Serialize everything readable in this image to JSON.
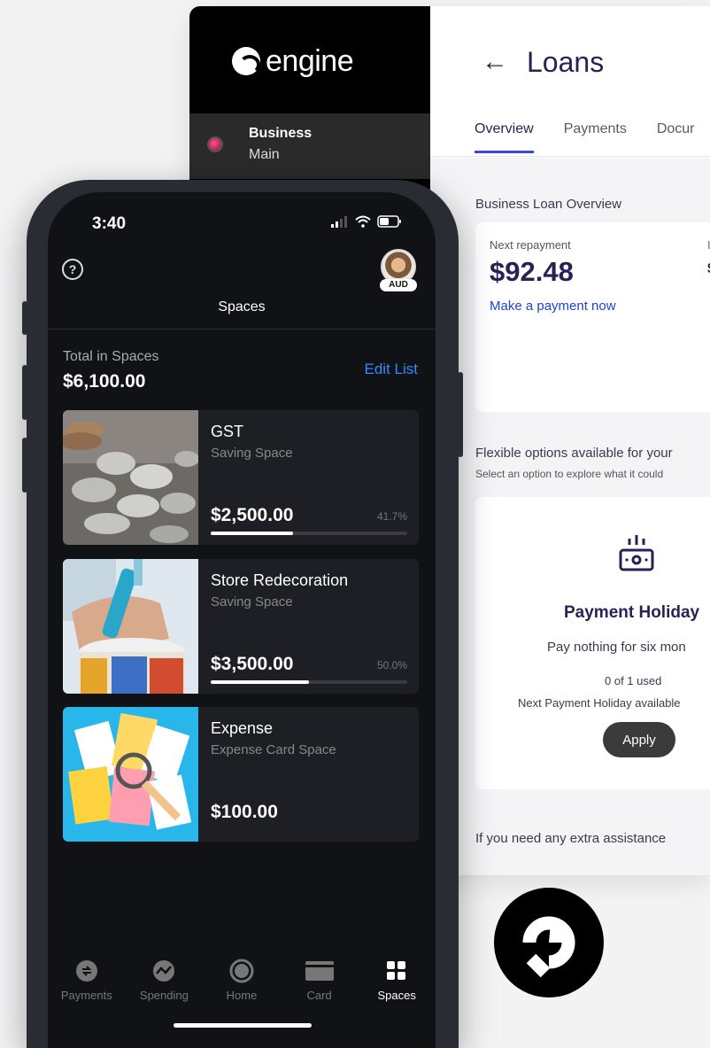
{
  "desktop": {
    "brand": "engine",
    "account": {
      "name": "Business",
      "sub": "Main"
    },
    "page_title": "Loans",
    "tabs": [
      "Overview",
      "Payments",
      "Docur"
    ],
    "overview": {
      "section_title": "Business Loan Overview",
      "next_repayment_label": "Next repayment",
      "next_repayment_amount": "$92.48",
      "make_payment_link": "Make a payment now",
      "cut_label": "I",
      "cut_value": "$"
    },
    "flexible": {
      "title": "Flexible options available for your",
      "subtitle": "Select an option to explore what it could"
    },
    "holiday": {
      "title": "Payment Holiday",
      "description": "Pay nothing for six mon",
      "used": "0 of 1 used",
      "next": "Next Payment Holiday available",
      "apply_label": "Apply"
    },
    "assistance": "If you need any extra assistance"
  },
  "phone": {
    "time": "3:40",
    "currency_badge": "AUD",
    "help_glyph": "?",
    "title": "Spaces",
    "total_label": "Total in Spaces",
    "total_value": "$6,100.00",
    "edit_list": "Edit List",
    "spaces": [
      {
        "name": "GST",
        "type": "Saving Space",
        "amount": "$2,500.00",
        "percent": "41.7%",
        "progress": 0.417
      },
      {
        "name": "Store Redecoration",
        "type": "Saving Space",
        "amount": "$3,500.00",
        "percent": "50.0%",
        "progress": 0.5
      },
      {
        "name": "Expense",
        "type": "Expense Card Space",
        "amount": "$100.00"
      }
    ],
    "tabbar": [
      {
        "label": "Payments",
        "icon": "payments-arrows-icon"
      },
      {
        "label": "Spending",
        "icon": "spending-chart-icon"
      },
      {
        "label": "Home",
        "icon": "home-circle-icon"
      },
      {
        "label": "Card",
        "icon": "card-icon"
      },
      {
        "label": "Spaces",
        "icon": "spaces-grid-icon",
        "active": true
      }
    ]
  },
  "colors": {
    "accent_blue": "#2f8cff",
    "link_blue": "#1f43d4",
    "navy_text": "#2b1f55",
    "tab_underline": "#3a4ae0"
  }
}
